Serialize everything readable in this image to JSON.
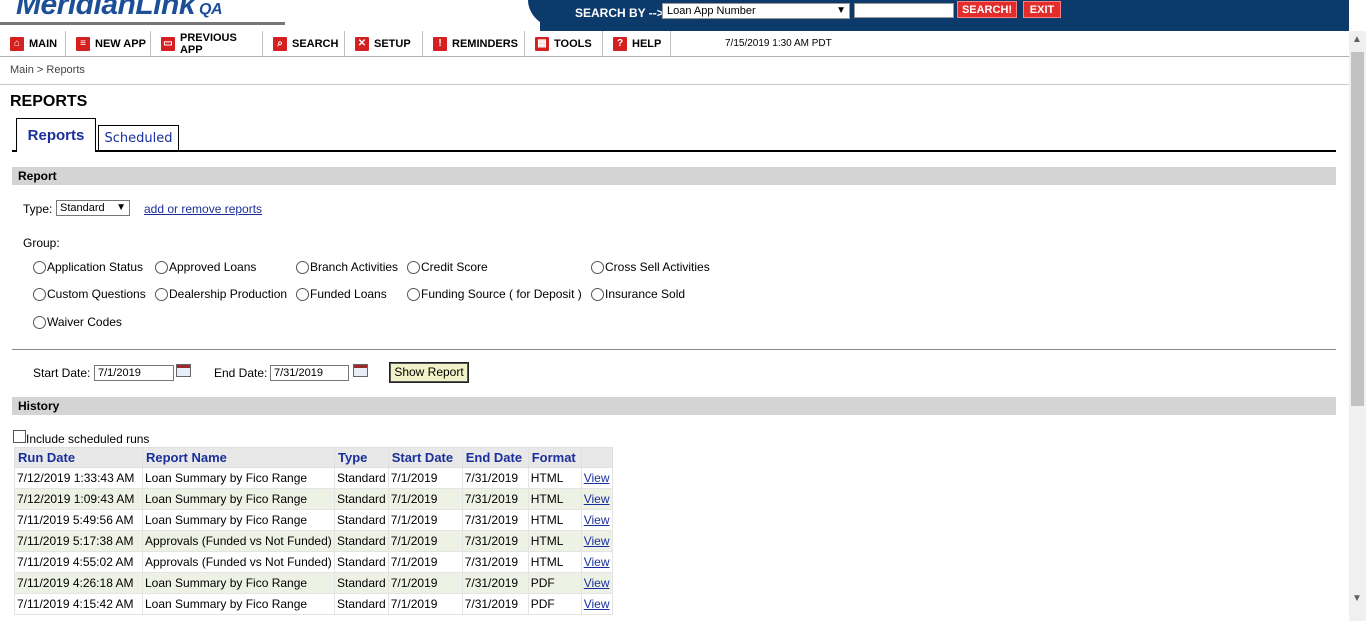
{
  "header": {
    "logo_text": "MeridianLink",
    "logo_suffix": "QA",
    "search_by_label": "SEARCH BY -->",
    "search_type_selected": "Loan App Number",
    "search_value": "",
    "search_button": "SEARCH!",
    "exit_button": "EXIT",
    "brand_color": "#0c3a6b",
    "accent_color": "#e32c2c"
  },
  "nav": {
    "items": [
      {
        "label": "MAIN",
        "icon": "home-icon"
      },
      {
        "label": "NEW APP",
        "icon": "new-app-icon"
      },
      {
        "label": "PREVIOUS APP",
        "icon": "previous-app-icon"
      },
      {
        "label": "SEARCH",
        "icon": "search-icon"
      },
      {
        "label": "SETUP",
        "icon": "setup-icon"
      },
      {
        "label": "REMINDERS",
        "icon": "reminders-icon"
      },
      {
        "label": "TOOLS",
        "icon": "tools-icon"
      },
      {
        "label": "HELP",
        "icon": "help-icon"
      }
    ],
    "datetime": "7/15/2019 1:30 AM PDT"
  },
  "breadcrumb": "Main > Reports",
  "page_title": "REPORTS",
  "tabs": {
    "active": "Reports",
    "inactive": "Scheduled"
  },
  "report_section": {
    "header": "Report",
    "type_label": "Type:",
    "type_selected": "Standard",
    "add_remove_link": "add or remove reports",
    "group_label": "Group:",
    "groups": [
      "Application Status",
      "Approved Loans",
      "Branch Activities",
      "Credit Score",
      "Cross Sell Activities",
      "Custom Questions",
      "Dealership Production",
      "Funded Loans",
      "Funding Source ( for Deposit )",
      "Insurance Sold",
      "Waiver Codes"
    ],
    "start_date_label": "Start Date:",
    "start_date": "7/1/2019",
    "end_date_label": "End Date:",
    "end_date": "7/31/2019",
    "show_report_button": "Show Report"
  },
  "history": {
    "header": "History",
    "include_scheduled_label": "Include scheduled runs",
    "columns": [
      "Run Date",
      "Report Name",
      "Type",
      "Start Date",
      "End Date",
      "Format",
      ""
    ],
    "rows": [
      [
        "7/12/2019 1:33:43 AM",
        "Loan Summary by Fico Range",
        "Standard",
        "7/1/2019",
        "7/31/2019",
        "HTML",
        "View"
      ],
      [
        "7/12/2019 1:09:43 AM",
        "Loan Summary by Fico Range",
        "Standard",
        "7/1/2019",
        "7/31/2019",
        "HTML",
        "View"
      ],
      [
        "7/11/2019 5:49:56 AM",
        "Loan Summary by Fico Range",
        "Standard",
        "7/1/2019",
        "7/31/2019",
        "HTML",
        "View"
      ],
      [
        "7/11/2019 5:17:38 AM",
        "Approvals (Funded vs Not Funded)",
        "Standard",
        "7/1/2019",
        "7/31/2019",
        "HTML",
        "View"
      ],
      [
        "7/11/2019 4:55:02 AM",
        "Approvals (Funded vs Not Funded)",
        "Standard",
        "7/1/2019",
        "7/31/2019",
        "HTML",
        "View"
      ],
      [
        "7/11/2019 4:26:18 AM",
        "Loan Summary by Fico Range",
        "Standard",
        "7/1/2019",
        "7/31/2019",
        "PDF",
        "View"
      ],
      [
        "7/11/2019 4:15:42 AM",
        "Loan Summary by Fico Range",
        "Standard",
        "7/1/2019",
        "7/31/2019",
        "PDF",
        "View"
      ]
    ]
  }
}
